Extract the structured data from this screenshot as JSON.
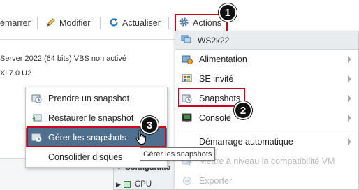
{
  "toolbar": {
    "demarrer_label": "émarrer",
    "modifier_label": "Modifier",
    "actualiser_label": "Actualiser",
    "actions_label": "Actions"
  },
  "summary": {
    "os_line": "Server 2022 (64 bits)  VBS non activé",
    "compat_line": "Xi 7.0 U2"
  },
  "context_menu": {
    "vm_name": "WS2k22",
    "items": [
      {
        "label": "Alimentation",
        "icon": "power-icon",
        "has_submenu": true,
        "enabled": true
      },
      {
        "label": "SE invité",
        "icon": "guest-os-icon",
        "has_submenu": true,
        "enabled": true
      },
      {
        "label": "Snapshots",
        "icon": "snapshot-icon",
        "has_submenu": true,
        "enabled": true
      },
      {
        "label": "Console",
        "icon": "console-icon",
        "has_submenu": true,
        "enabled": true
      },
      {
        "label": "Démarrage automatique",
        "icon": "",
        "has_submenu": true,
        "enabled": true
      },
      {
        "label": "Mettre à niveau la compatibilité VM",
        "icon": "upgrade-icon",
        "has_submenu": false,
        "enabled": false
      },
      {
        "label": "Exporter",
        "icon": "export-icon",
        "has_submenu": false,
        "enabled": false
      }
    ]
  },
  "snapshot_submenu": {
    "items": [
      {
        "label": "Prendre un snapshot",
        "icon": "take-snapshot-icon",
        "highlighted": false
      },
      {
        "label": "Restaurer le snapshot",
        "icon": "restore-snapshot-icon",
        "highlighted": false
      },
      {
        "label": "Gérer les snapshots",
        "icon": "manage-snapshots-icon",
        "highlighted": true
      },
      {
        "label": "Consolider disques",
        "icon": "",
        "highlighted": false
      }
    ]
  },
  "tooltip": "Gérer les snapshots",
  "config_panel": {
    "header": "Configuratio",
    "cpu_label": "CPU"
  },
  "badges": [
    "1",
    "2",
    "3"
  ],
  "colors": {
    "highlight": "#d0021b",
    "selected_bg": "#4f6f8f",
    "accent_blue": "#1a73b8"
  }
}
